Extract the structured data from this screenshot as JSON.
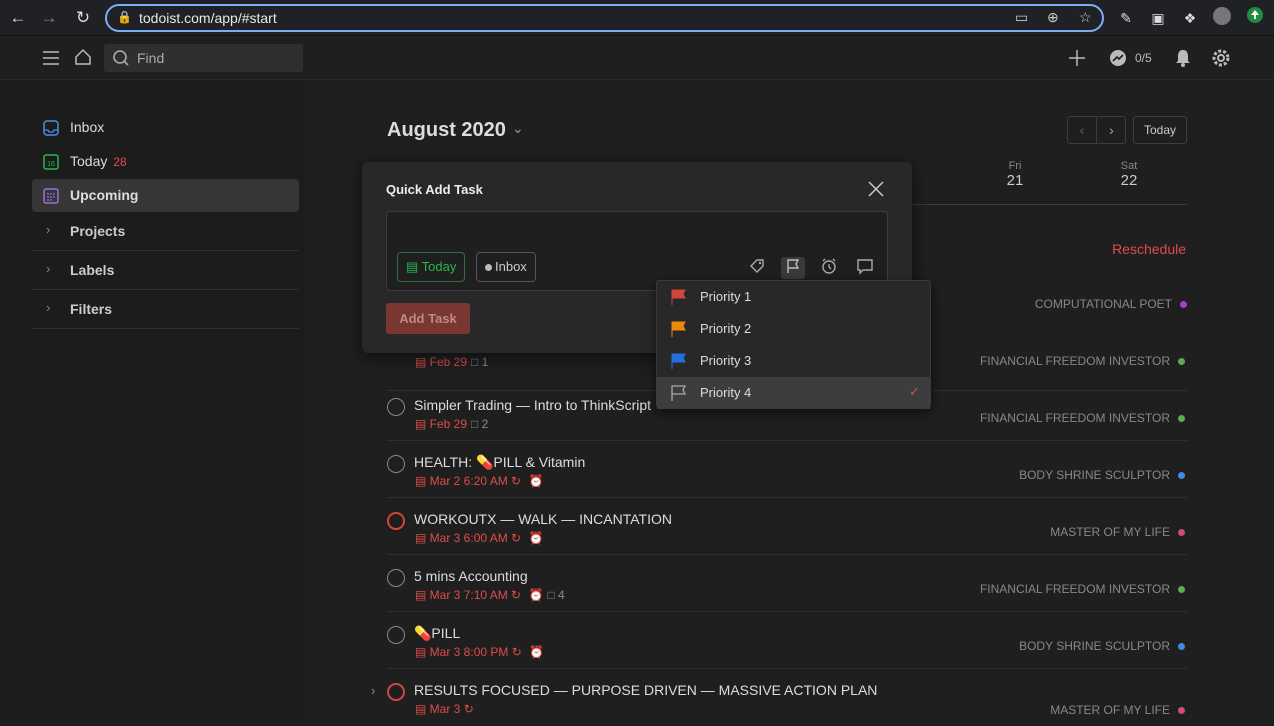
{
  "browser": {
    "url": "todoist.com/app/#start"
  },
  "topbar": {
    "search_placeholder": "Find",
    "karma": "0/5"
  },
  "sidebar": {
    "items": [
      {
        "label": "Inbox",
        "count": ""
      },
      {
        "label": "Today",
        "count": "28"
      },
      {
        "label": "Upcoming",
        "count": ""
      }
    ],
    "sections": [
      {
        "label": "Projects"
      },
      {
        "label": "Labels"
      },
      {
        "label": "Filters"
      }
    ]
  },
  "header": {
    "month": "August 2020",
    "today_button": "Today",
    "reschedule": "Reschedule"
  },
  "week": [
    {
      "dow": "Fri",
      "day": "21"
    },
    {
      "dow": "Sat",
      "day": "22"
    }
  ],
  "tasks": [
    {
      "title": "",
      "date": "Feb 29",
      "meta": "1",
      "project": "FINANCIAL FREEDOM INVESTOR",
      "dot": "#5fab4f"
    },
    {
      "title": "Simpler Trading — Intro to ThinkScript",
      "date": "Feb 29",
      "meta": "2",
      "project": "FINANCIAL FREEDOM INVESTOR",
      "dot": "#5fab4f"
    },
    {
      "title": "HEALTH: 💊PILL & Vitamin",
      "date": "Mar 2 6:20 AM",
      "meta": "",
      "project": "BODY SHRINE SCULPTOR",
      "dot": "#3a8ee6"
    },
    {
      "title": "WORKOUTX — WALK — INCANTATION",
      "date": "Mar 3 6:00 AM",
      "meta": "",
      "project": "MASTER OF MY LIFE",
      "dot": "#d04a7a"
    },
    {
      "title": "5 mins Accounting",
      "date": "Mar 3 7:10 AM",
      "meta": "4",
      "project": "FINANCIAL FREEDOM INVESTOR",
      "dot": "#5fab4f"
    },
    {
      "title": "💊PILL",
      "date": "Mar 3 8:00 PM",
      "meta": "",
      "project": "BODY SHRINE SCULPTOR",
      "dot": "#3a8ee6"
    },
    {
      "title": "RESULTS FOCUSED — PURPOSE DRIVEN — MASSIVE ACTION PLAN",
      "date": "Mar 3",
      "meta": "",
      "project": "MASTER OF MY LIFE",
      "dot": "#d04a7a"
    }
  ],
  "first_project": {
    "project": "COMPUTATIONAL POET",
    "dot": "#a03fcf"
  },
  "quick_add": {
    "title": "Quick Add Task",
    "date_chip": "Today",
    "project_chip": "Inbox",
    "add_button": "Add Task"
  },
  "priority_menu": {
    "options": [
      {
        "label": "Priority 1",
        "color": "#d1453b"
      },
      {
        "label": "Priority 2",
        "color": "#eb8909"
      },
      {
        "label": "Priority 3",
        "color": "#246fe0"
      },
      {
        "label": "Priority 4",
        "color": "#aaaaaa"
      }
    ],
    "selected": "Priority 4"
  }
}
